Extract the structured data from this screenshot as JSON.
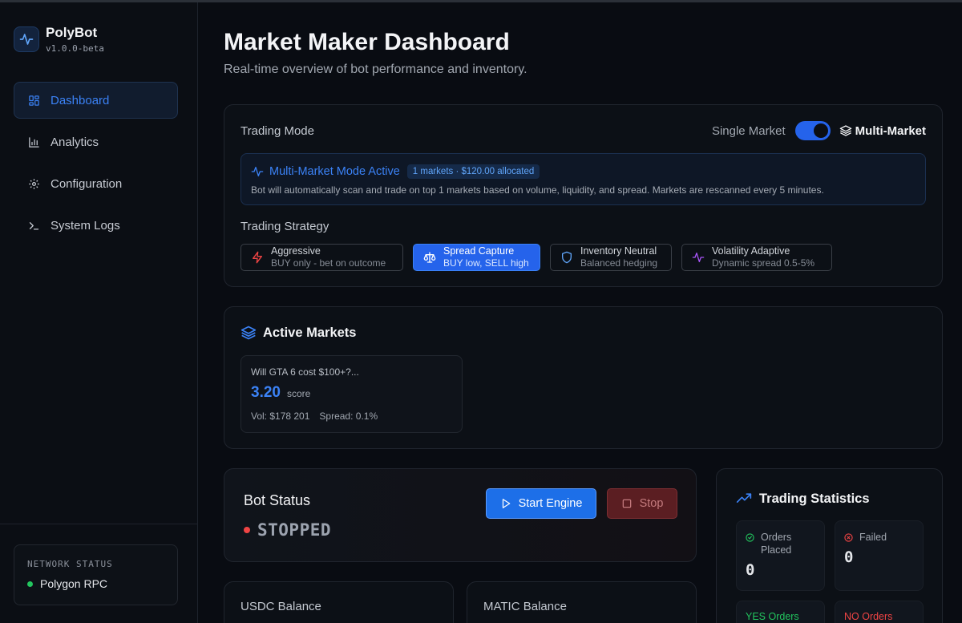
{
  "app": {
    "name": "PolyBot",
    "version": "v1.0.0-beta"
  },
  "colors": {
    "accent": "#3b82f6",
    "danger": "#ef4444",
    "success": "#22c55e",
    "background": "#090c12"
  },
  "sidebar": {
    "items": [
      {
        "label": "Dashboard",
        "icon": "grid-icon",
        "active": true
      },
      {
        "label": "Analytics",
        "icon": "bar-chart-icon",
        "active": false
      },
      {
        "label": "Configuration",
        "icon": "gear-icon",
        "active": false
      },
      {
        "label": "System Logs",
        "icon": "terminal-icon",
        "active": false
      }
    ],
    "network": {
      "label": "NETWORK STATUS",
      "value": "Polygon RPC"
    }
  },
  "header": {
    "title": "Market Maker Dashboard",
    "subtitle": "Real-time overview of bot performance and inventory."
  },
  "trading_mode": {
    "label": "Trading Mode",
    "single_label": "Single Market",
    "multi_label": "Multi-Market",
    "multi_enabled": true,
    "info_title": "Multi-Market Mode Active",
    "info_badge": "1 markets · $120.00 allocated",
    "info_desc": "Bot will automatically scan and trade on top 1 markets based on volume, liquidity, and spread. Markets are rescanned every 5 minutes."
  },
  "strategy": {
    "label": "Trading Strategy",
    "options": [
      {
        "name": "Aggressive",
        "desc": "BUY only - bet on outcome",
        "icon": "bolt-icon",
        "selected": false
      },
      {
        "name": "Spread Capture",
        "desc": "BUY low, SELL high",
        "icon": "scale-icon",
        "selected": true
      },
      {
        "name": "Inventory Neutral",
        "desc": "Balanced hedging",
        "icon": "shield-icon",
        "selected": false
      },
      {
        "name": "Volatility Adaptive",
        "desc": "Dynamic spread 0.5-5%",
        "icon": "pulse-icon",
        "selected": false
      }
    ]
  },
  "active_markets": {
    "title": "Active Markets",
    "items": [
      {
        "question": "Will GTA 6 cost $100+?...",
        "score": "3.20",
        "score_label": "score",
        "volume": "Vol: $178 201",
        "spread": "Spread: 0.1%"
      }
    ]
  },
  "bot_status": {
    "title": "Bot Status",
    "state": "STOPPED",
    "start_label": "Start Engine",
    "stop_label": "Stop"
  },
  "balances": {
    "usdc_label": "USDC Balance",
    "matic_label": "MATIC Balance"
  },
  "stats": {
    "title": "Trading Statistics",
    "orders_placed_label": "Orders Placed",
    "orders_placed": "0",
    "failed_label": "Failed",
    "failed": "0",
    "yes_label": "YES Orders",
    "no_label": "NO Orders"
  }
}
